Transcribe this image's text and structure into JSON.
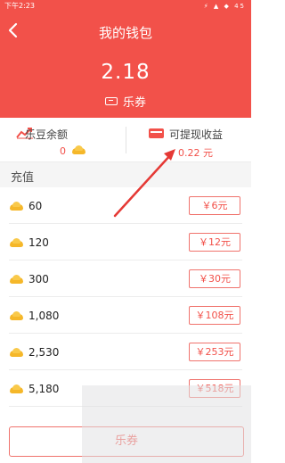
{
  "statusbar": {
    "time": "下午2:23",
    "icons": "⚡ ▲ ◆ 45"
  },
  "header": {
    "title": "我的钱包",
    "balance": "2.18",
    "balance_unit": "乐券",
    "background_color": "#f2514a"
  },
  "stats": {
    "ledou": {
      "label": "乐豆余额",
      "value": "0",
      "icon": "trend-chart-icon"
    },
    "withdraw": {
      "label": "可提现收益",
      "value": "0.22 元",
      "icon": "card-icon"
    }
  },
  "recharge": {
    "title": "充值",
    "items": [
      {
        "amount": "60",
        "price": "￥6元"
      },
      {
        "amount": "120",
        "price": "￥12元"
      },
      {
        "amount": "300",
        "price": "￥30元"
      },
      {
        "amount": "1,080",
        "price": "￥108元"
      },
      {
        "amount": "2,530",
        "price": "￥253元"
      },
      {
        "amount": "5,180",
        "price": "￥518元"
      }
    ]
  },
  "bottom_button": {
    "label": "乐券"
  },
  "colors": {
    "accent": "#f2514a",
    "coin": "#f5b729"
  }
}
